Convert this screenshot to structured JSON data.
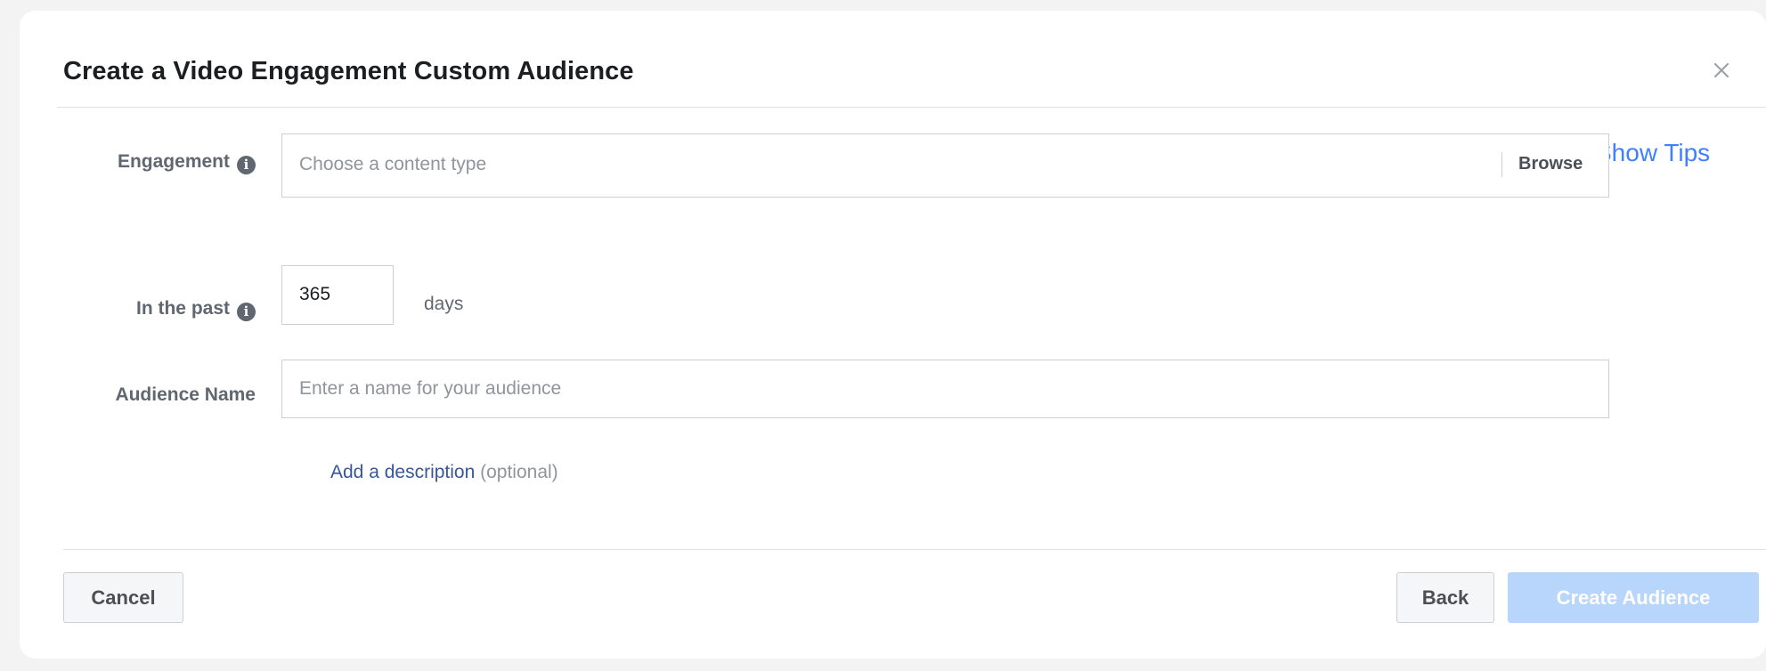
{
  "dialog": {
    "title": "Create a Video Engagement Custom Audience",
    "close_icon": "close-icon"
  },
  "tips": {
    "label": "Show Tips",
    "icon": "chevron-left-circle-icon",
    "color": "#4080ff"
  },
  "form": {
    "engagement": {
      "label": "Engagement",
      "info_icon": "info-icon",
      "placeholder": "Choose a content type",
      "browse_label": "Browse"
    },
    "retention": {
      "label": "In the past",
      "info_icon": "info-icon",
      "value": "365",
      "unit": "days"
    },
    "audience_name": {
      "label": "Audience Name",
      "placeholder": "Enter a name for your audience"
    },
    "description": {
      "link_label": "Add a description",
      "optional_label": "(optional)"
    }
  },
  "footer": {
    "cancel_label": "Cancel",
    "back_label": "Back",
    "create_label": "Create Audience",
    "create_disabled": true,
    "create_color": "#b8d6fb"
  }
}
